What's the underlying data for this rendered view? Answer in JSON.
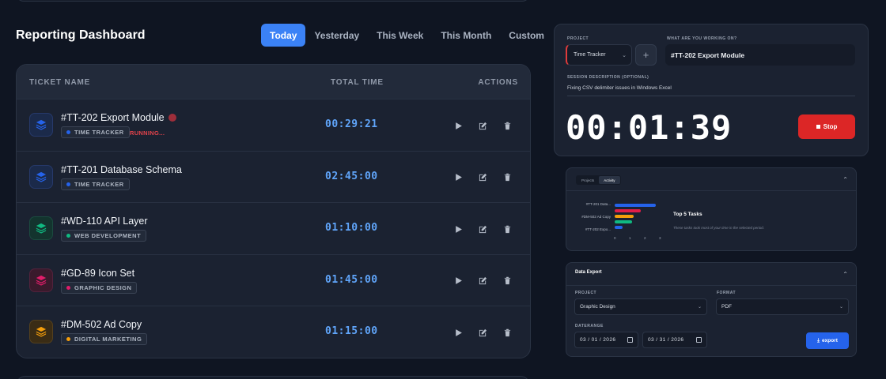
{
  "header": {
    "title": "Reporting Dashboard",
    "ranges": [
      "Today",
      "Yesterday",
      "This Week",
      "This Month",
      "Custom"
    ],
    "active_range": "Today"
  },
  "table": {
    "columns": {
      "name": "TICKET NAME",
      "time": "TOTAL TIME",
      "actions": "ACTIONS"
    },
    "rows": [
      {
        "title": "#TT-202 Export Module",
        "badge": "TIME TRACKER",
        "status": "RUNNING...",
        "time": "00:29:21",
        "color": "#2563eb",
        "icon_bg": "#1b2a4a",
        "icon_border": "#26396a"
      },
      {
        "title": "#TT-201 Database Schema",
        "badge": "TIME TRACKER",
        "status": "",
        "time": "02:45:00",
        "color": "#2563eb",
        "icon_bg": "#1b2a4a",
        "icon_border": "#26396a"
      },
      {
        "title": "#WD-110 API Layer",
        "badge": "WEB DEVELOPMENT",
        "status": "",
        "time": "01:10:00",
        "color": "#10b981",
        "icon_bg": "#13342e",
        "icon_border": "#1b4a3f"
      },
      {
        "title": "#GD-89 Icon Set",
        "badge": "GRAPHIC DESIGN",
        "status": "",
        "time": "01:45:00",
        "color": "#e11d6a",
        "icon_bg": "#3a1a2c",
        "icon_border": "#52223c"
      },
      {
        "title": "#DM-502 Ad Copy",
        "badge": "DIGITAL MARKETING",
        "status": "",
        "time": "01:15:00",
        "color": "#f59e0b",
        "icon_bg": "#3a2c15",
        "icon_border": "#54401d"
      }
    ]
  },
  "timer": {
    "project_label": "PROJECT",
    "project_value": "Time Tracker",
    "work_label": "WHAT ARE YOU WORKING ON?",
    "work_value": "#TT-202 Export Module",
    "desc_label": "SESSION DESCRIPTION (OPTIONAL)",
    "desc_value": "Fixing CSV delimiter issues in Windows Excel",
    "elapsed": "00:01:39",
    "stop_label": "Stop",
    "accent": "#e03b3b"
  },
  "activity": {
    "tabs": [
      "Projects",
      "Activity"
    ],
    "active_tab": "Activity",
    "top5_title": "Top 5 Tasks",
    "top5_subtitle": "These tasks took most of your time in the selected period."
  },
  "chart_data": {
    "type": "bar",
    "orientation": "horizontal",
    "tick_labels": [
      "#TT-201 Data...",
      "#DM-502 Ad Copy",
      "#TT-202 Expo..."
    ],
    "values": [
      2.75,
      1.75,
      1.25,
      1.17,
      0.5
    ],
    "colors": [
      "#2563eb",
      "#e11d48",
      "#f59e0b",
      "#10b981",
      "#2563eb"
    ],
    "xticks": [
      0,
      1,
      2,
      3
    ],
    "xlim": [
      0,
      3
    ]
  },
  "export": {
    "title": "Data Export",
    "project_label": "PROJECT",
    "project_value": "Graphic Design",
    "format_label": "FORMAT",
    "format_value": "PDF",
    "range_label": "DATERANGE",
    "date_from": "03 / 01 / 2026",
    "date_to": "03 / 31 / 2026",
    "button_label": "export"
  }
}
